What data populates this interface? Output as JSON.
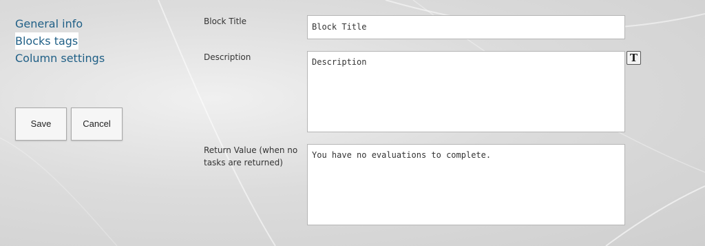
{
  "nav": {
    "items": [
      {
        "label": "General info"
      },
      {
        "label": "Blocks tags"
      },
      {
        "label": "Column settings"
      }
    ]
  },
  "actions": {
    "save_label": "Save",
    "cancel_label": "Cancel"
  },
  "form": {
    "block_title": {
      "label": "Block Title",
      "value": "Block Title"
    },
    "description": {
      "label": "Description",
      "value": "Description",
      "format_icon": "text-format-icon",
      "format_glyph": "T"
    },
    "return_value": {
      "label": "Return Value (when no tasks are returned)",
      "value": "You have no evaluations to complete."
    }
  }
}
